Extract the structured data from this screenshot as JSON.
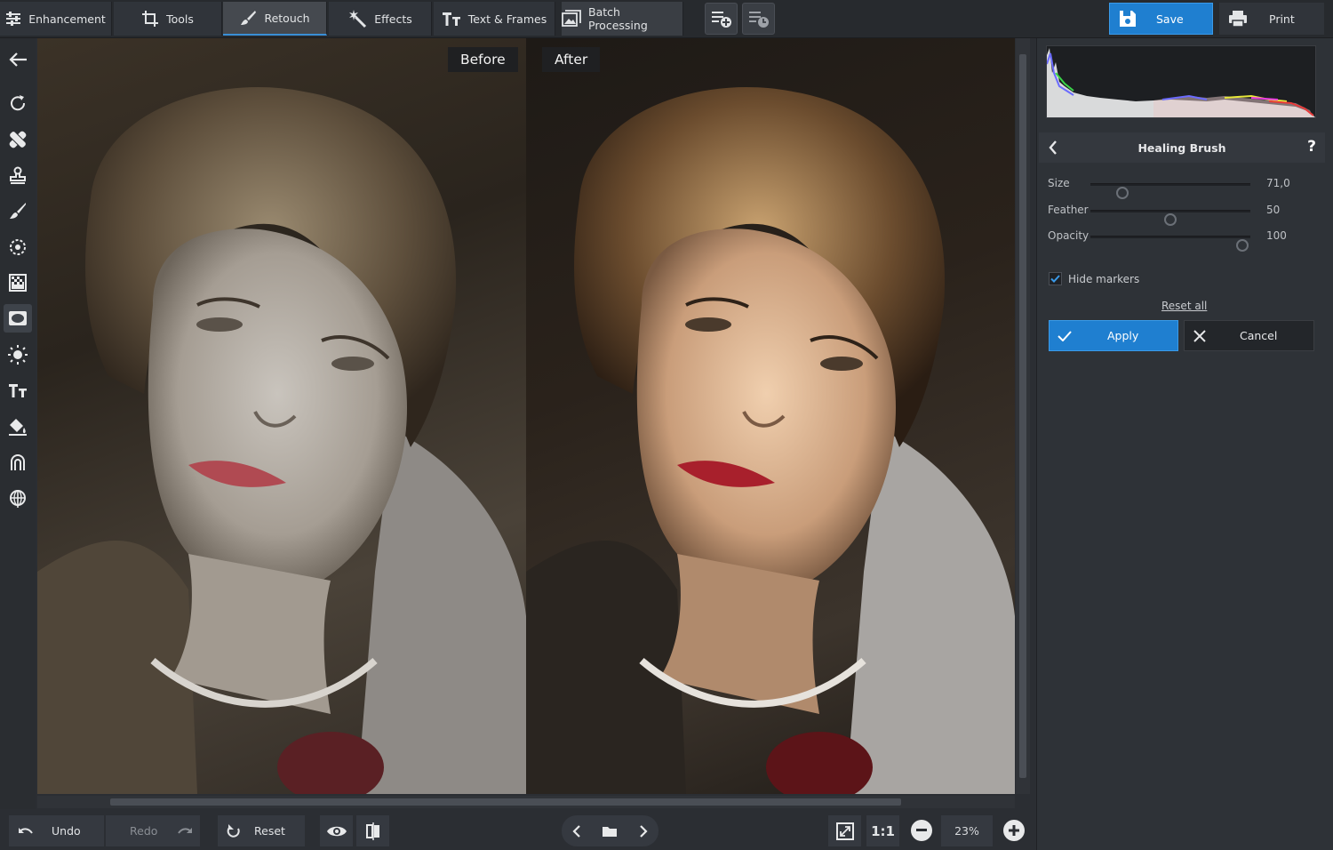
{
  "tabs": [
    {
      "label": "Enhancement",
      "icon": "sliders-icon"
    },
    {
      "label": "Tools",
      "icon": "crop-icon"
    },
    {
      "label": "Retouch",
      "icon": "brush-icon",
      "active": true
    },
    {
      "label": "Effects",
      "icon": "magic-wand-icon"
    },
    {
      "label": "Text & Frames",
      "icon": "text-icon"
    },
    {
      "label": "Batch Processing",
      "icon": "images-icon"
    }
  ],
  "toolbar": {
    "save_label": "Save",
    "print_label": "Print"
  },
  "canvas": {
    "before_label": "Before",
    "after_label": "After"
  },
  "bottombar": {
    "undo_label": "Undo",
    "redo_label": "Redo",
    "reset_label": "Reset",
    "one_to_one_label": "1:1",
    "zoom_value": "23%"
  },
  "panel": {
    "title": "Healing Brush",
    "help_label": "?",
    "sliders": [
      {
        "label": "Size",
        "value": "71,0",
        "fraction": 0.2
      },
      {
        "label": "Feather",
        "value": "50",
        "fraction": 0.5
      },
      {
        "label": "Opacity",
        "value": "100",
        "fraction": 0.95
      }
    ],
    "hide_markers_label": "Hide markers",
    "hide_markers_checked": true,
    "reset_all_label": "Reset all",
    "apply_label": "Apply",
    "cancel_label": "Cancel"
  },
  "colors": {
    "accent": "#1f7fd0",
    "background": "#2b2e33",
    "panel": "#2e3237"
  }
}
